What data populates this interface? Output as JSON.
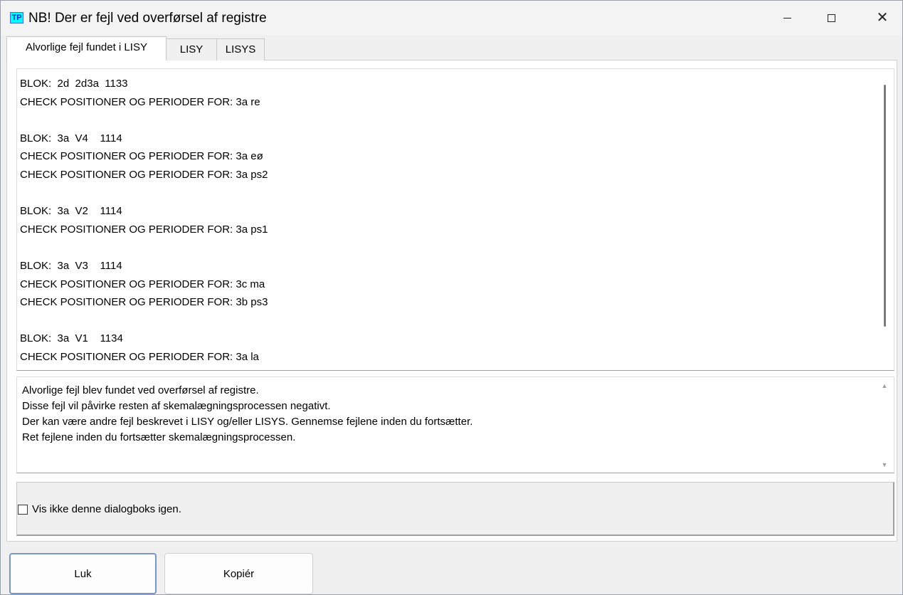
{
  "window": {
    "icon_text": "TP",
    "title": "NB! Der er fejl ved overførsel af registre",
    "close_glyph": "✕"
  },
  "tabs": [
    {
      "label": "Alvorlige fejl fundet i LISY",
      "active": true
    },
    {
      "label": "LISY",
      "active": false
    },
    {
      "label": "LISYS",
      "active": false
    }
  ],
  "log": {
    "text": "BLOK:  2d  2d3a  1133\nCHECK POSITIONER OG PERIODER FOR: 3a re\n\nBLOK:  3a  V4    1114\nCHECK POSITIONER OG PERIODER FOR: 3a eø\nCHECK POSITIONER OG PERIODER FOR: 3a ps2\n\nBLOK:  3a  V2    1114\nCHECK POSITIONER OG PERIODER FOR: 3a ps1\n\nBLOK:  3a  V3    1114\nCHECK POSITIONER OG PERIODER FOR: 3c ma\nCHECK POSITIONER OG PERIODER FOR: 3b ps3\n\nBLOK:  3a  V1    1134\nCHECK POSITIONER OG PERIODER FOR: 3a la"
  },
  "message": {
    "text": "Alvorlige fejl blev fundet ved overførsel af registre.\nDisse fejl vil påvirke resten af skemalægningsprocessen negativt.\nDer kan være andre fejl beskrevet i LISY og/eller LISYS. Gennemse fejlene inden du fortsætter.\nRet fejlene inden du fortsætter skemalægningsprocessen."
  },
  "checkbox": {
    "label": "Vis ikke denne dialogboks igen.",
    "checked": false
  },
  "buttons": {
    "close_label": "Luk",
    "copy_label": "Kopiér"
  },
  "icons": {
    "scroll_up": "▲",
    "scroll_down": "▼"
  }
}
